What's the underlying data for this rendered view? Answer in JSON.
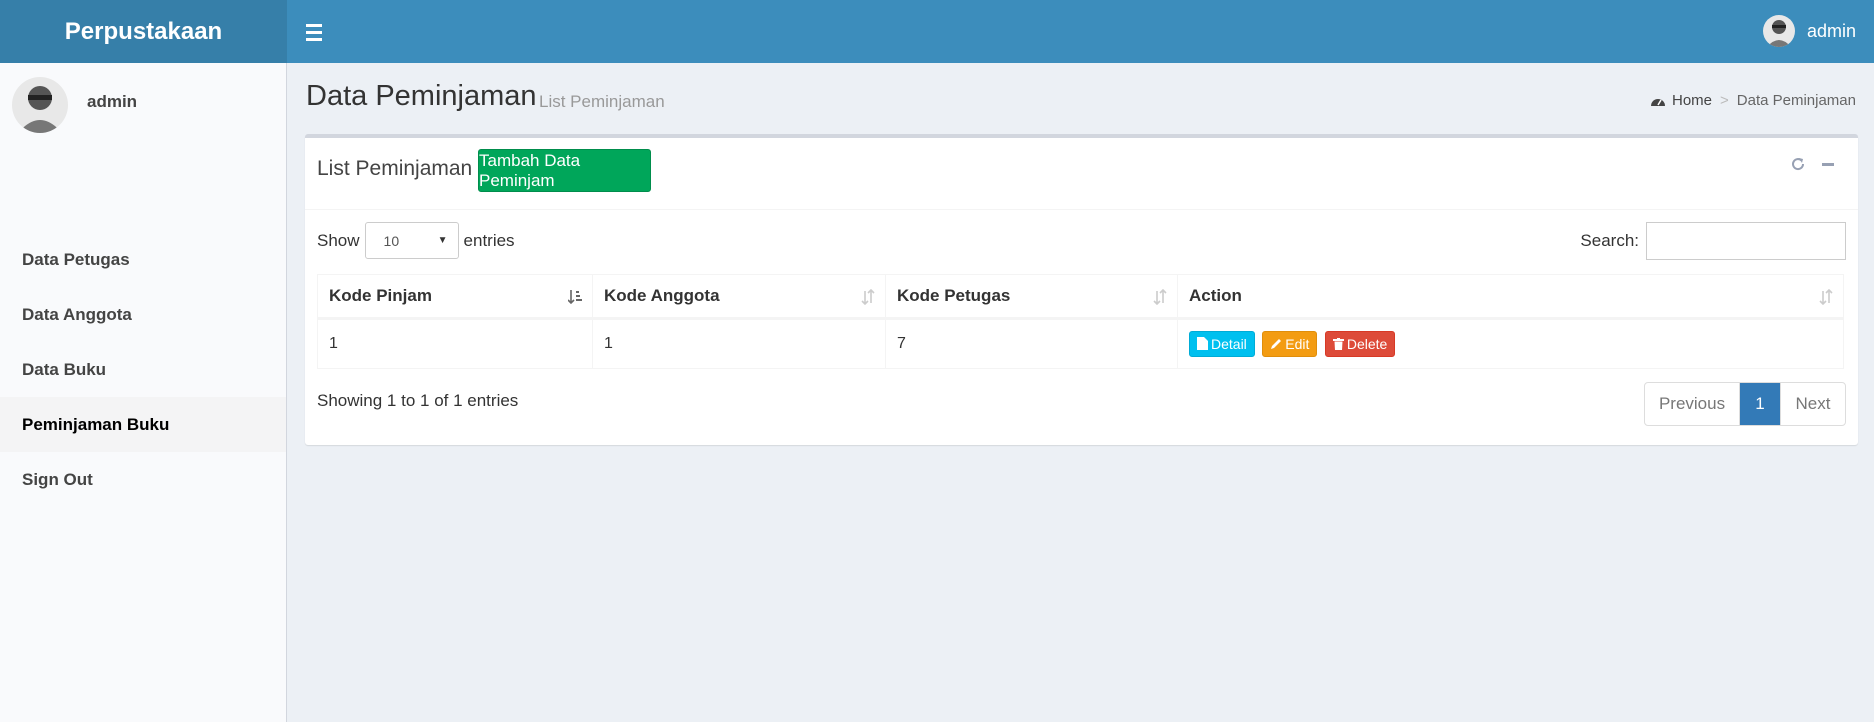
{
  "app": {
    "name": "Perpustakaan"
  },
  "header": {
    "user_name": "admin"
  },
  "sidebar": {
    "user_name": "admin",
    "items": [
      {
        "label": "Data Petugas"
      },
      {
        "label": "Data Anggota"
      },
      {
        "label": "Data Buku"
      },
      {
        "label": "Peminjaman Buku",
        "active": true
      },
      {
        "label": "Sign Out"
      }
    ]
  },
  "page": {
    "title": "Data Peminjaman",
    "subtitle": "List Peminjaman"
  },
  "breadcrumb": {
    "home": "Home",
    "separator": ">",
    "current": "Data Peminjaman"
  },
  "box": {
    "title": "List Peminjaman",
    "add_button": "Tambah Data Peminjam"
  },
  "table_controls": {
    "show_label": "Show",
    "entries_value": "10",
    "entries_label": "entries",
    "search_label": "Search:",
    "search_value": ""
  },
  "table": {
    "columns": [
      "Kode Pinjam",
      "Kode Anggota",
      "Kode Petugas",
      "Action"
    ],
    "rows": [
      {
        "kode_pinjam": "1",
        "kode_anggota": "1",
        "kode_petugas": "7"
      }
    ],
    "actions": {
      "detail": "Detail",
      "edit": "Edit",
      "delete": "Delete"
    }
  },
  "footer": {
    "info": "Showing 1 to 1 of 1 entries",
    "previous": "Previous",
    "current_page": "1",
    "next": "Next"
  },
  "colors": {
    "header": "#3c8dbc",
    "logo_bg": "#367fa9",
    "add_button": "#00a65a",
    "detail": "#00c0ef",
    "edit": "#f39c12",
    "delete": "#dd4b39",
    "page_active": "#337ab7"
  }
}
